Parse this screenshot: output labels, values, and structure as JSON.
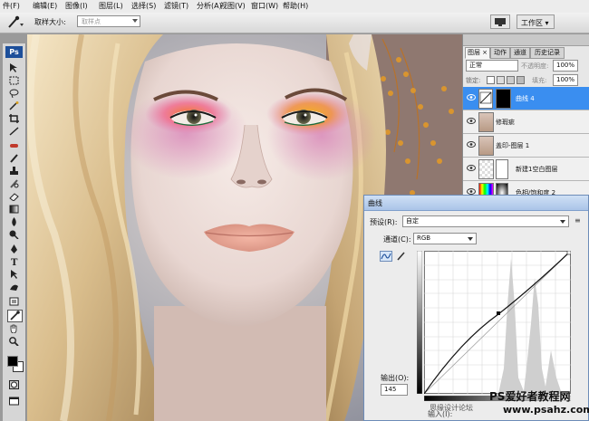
{
  "menubar": {
    "file_partial": "件(F)",
    "items": [
      "编辑(E)",
      "图像(I)",
      "图层(L)",
      "选择(S)",
      "滤镜(T)",
      "分析(A)",
      "视图(V)",
      "窗口(W)",
      "帮助(H)"
    ]
  },
  "options_bar": {
    "sample_size_label": "取样大小:",
    "sample_value": "取样点",
    "workspace_label": "工作区 ▾"
  },
  "toolbox": {
    "logo": "Ps"
  },
  "layers_panel": {
    "tabs": [
      "图层 ×",
      "动作",
      "通道",
      "历史记录"
    ],
    "blend_mode": "正常",
    "opacity_label": "不透明度:",
    "opacity_value": "100%",
    "lock_label": "锁定:",
    "fill_label": "填充:",
    "fill_value": "100%",
    "layers": [
      {
        "name": "曲线 4",
        "selected": true
      },
      {
        "name": "修瑕疵",
        "selected": false
      },
      {
        "name": "盖印-图层 1",
        "selected": false
      },
      {
        "name": "新建1空白图层",
        "selected": false
      },
      {
        "name": "色相/饱和度 2",
        "selected": false
      }
    ]
  },
  "curves_dialog": {
    "title": "曲线",
    "preset_label": "预设(R):",
    "preset_value": "自定",
    "channel_label": "通道(C):",
    "channel_value": "RGB",
    "output_label": "输出(O):",
    "output_value": "145",
    "input_partial": "输入(I):"
  },
  "watermarks": {
    "line1": "PS爱好者教程网",
    "line2": "www.psahz.com",
    "line3": "思缘设计论坛"
  },
  "colors": {
    "accent": "#3a8ef0",
    "ps_blue": "#1d4f9a",
    "dialog_title": "#aac4e8"
  }
}
